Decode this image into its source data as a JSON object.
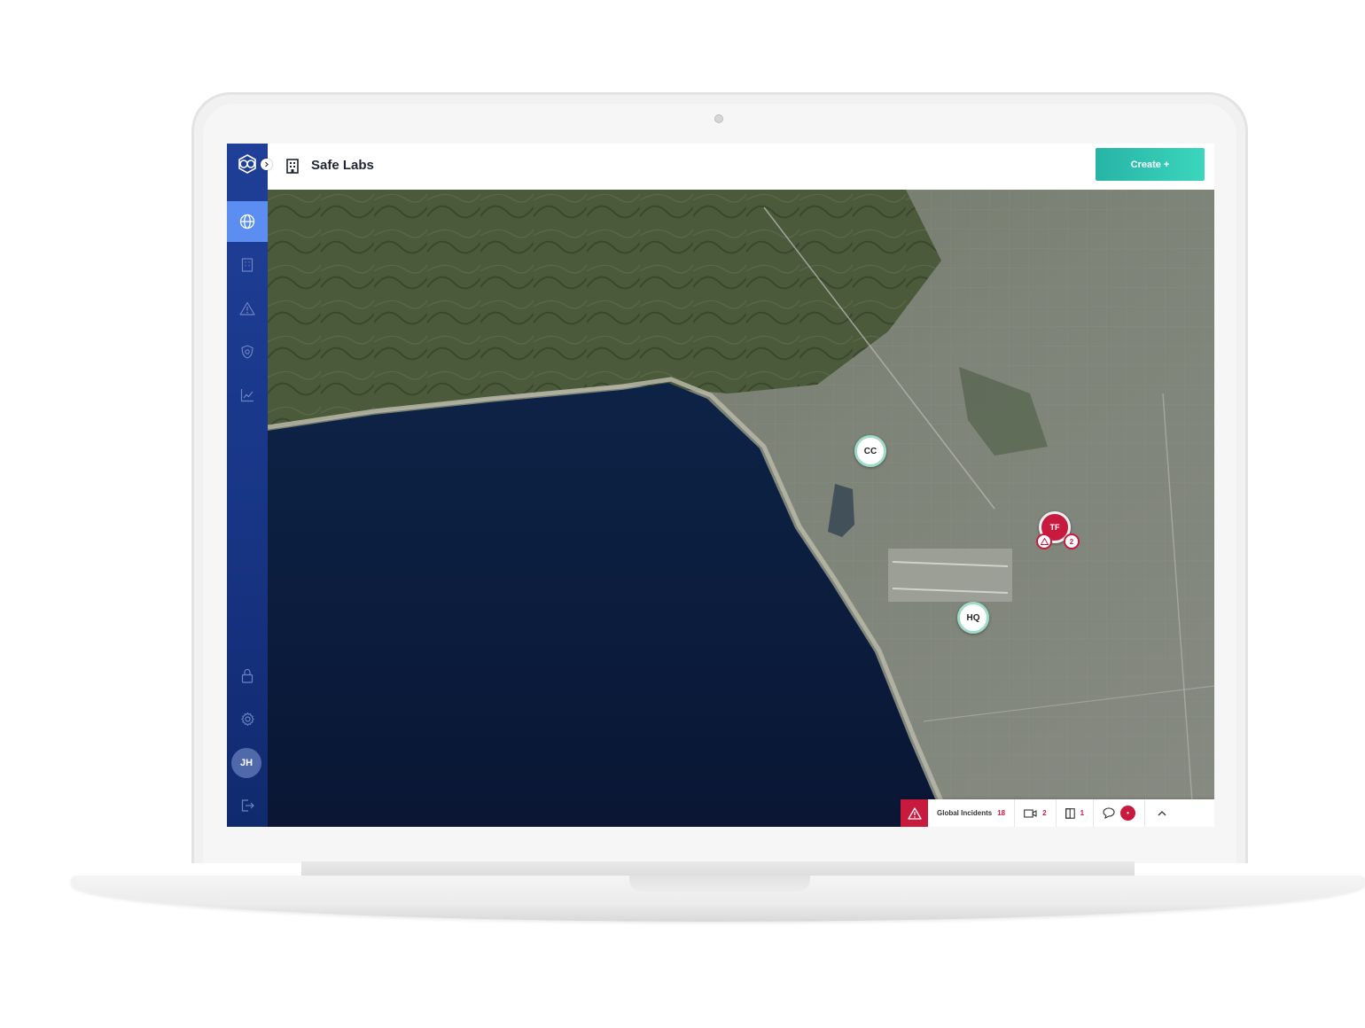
{
  "app": {
    "title": "Safe Labs",
    "create_label": "Create +"
  },
  "sidebar": {
    "items": [
      {
        "name": "globe-icon",
        "active": true
      },
      {
        "name": "building-icon"
      },
      {
        "name": "alert-icon"
      },
      {
        "name": "shield-icon"
      },
      {
        "name": "chart-icon"
      }
    ],
    "bottom": [
      {
        "name": "lock-icon"
      },
      {
        "name": "gear-icon"
      },
      {
        "name": "avatar"
      },
      {
        "name": "logout-icon"
      }
    ],
    "avatar_initials": "JH"
  },
  "map": {
    "markers": [
      {
        "label": "CC",
        "status": "normal"
      },
      {
        "label": "TF",
        "status": "alert",
        "alerts": "2"
      },
      {
        "label": "HQ",
        "status": "normal"
      }
    ]
  },
  "statusbar": {
    "incidents_label": "Global Incidents",
    "incidents_count": "18",
    "camera_count": "2",
    "door_count": "1",
    "chat_badge": "•"
  },
  "colors": {
    "sidebar": "#1f3f98",
    "sidebar_active": "#5b8ef0",
    "alert": "#c8193f",
    "create_gradient_start": "#27b4a6",
    "create_gradient_end": "#3bd6bd",
    "marker_ring": "#9fdcc8"
  }
}
